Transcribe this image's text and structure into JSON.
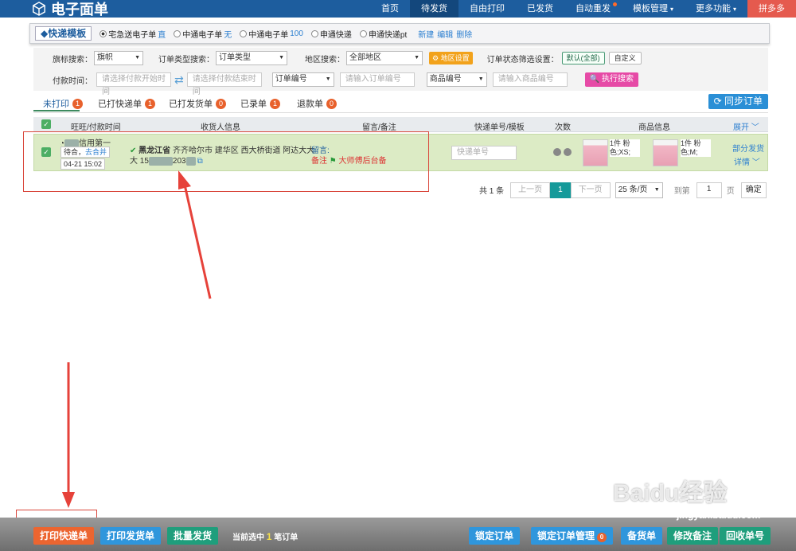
{
  "header": {
    "title": "电子面单",
    "nav": [
      {
        "label": "首页"
      },
      {
        "label": "待发货",
        "active": true
      },
      {
        "label": "自由打印"
      },
      {
        "label": "已发货"
      },
      {
        "label": "自动重发",
        "dot": true
      },
      {
        "label": "模板管理",
        "caret": "▾"
      },
      {
        "label": "更多功能",
        "caret": "▾"
      },
      {
        "label": "拼多多"
      }
    ]
  },
  "template_bar": {
    "title": "快递模板",
    "options": [
      {
        "label": "宅急送电子单",
        "tag": "直",
        "checked": true
      },
      {
        "label": "中通电子单",
        "tag": "无"
      },
      {
        "label": "中通电子单",
        "tag": "100"
      },
      {
        "label": "申通快递",
        "tag": ""
      },
      {
        "label": "申通快递pt",
        "tag": ""
      }
    ],
    "links": [
      "新建",
      "编辑",
      "删除"
    ]
  },
  "filters": {
    "flag_label": "旗标搜索：",
    "flag_value": "旗帜",
    "order_type_label": "订单类型搜索：",
    "order_type_value": "订单类型",
    "region_label": "地区搜索：",
    "region_value": "全部地区",
    "region_btn": "地区设置",
    "status_label": "订单状态筛选设置：",
    "status_default": "默认(全部)",
    "status_custom": "自定义",
    "pay_time_label": "付款时间：",
    "pay_start_ph": "请选择付款开始时间",
    "pay_end_ph": "请选择付款结束时间",
    "order_no_sel": "订单编号",
    "order_no_ph": "请输入订单编号",
    "goods_no_sel": "商品编号",
    "goods_no_ph": "请输入商品编号",
    "search_btn": "执行搜索"
  },
  "tabs": [
    {
      "label": "未打印",
      "count": "1"
    },
    {
      "label": "已打快递单",
      "count": "1"
    },
    {
      "label": "已打发货单",
      "count": "0"
    },
    {
      "label": "已录单",
      "count": "1"
    },
    {
      "label": "退款单",
      "count": "0"
    }
  ],
  "sync_btn": "同步订单",
  "table": {
    "headers": {
      "buyer": "旺旺/付款时间",
      "receiver": "收货人信息",
      "remark": "留言/备注",
      "express": "快递单号/模板",
      "times": "次数",
      "goods": "商品信息",
      "expand": "展开"
    },
    "row": {
      "buyer_tail": "信用第一",
      "status": "待合",
      "merge_link": "去合并",
      "pay_time": "04-21 15:02",
      "province": "黑龙江省",
      "address": "齐齐哈尔市 建华区 西大桥街道 阿达大大",
      "name_line": "大 15",
      "phone_mid": "203",
      "msg_label": "留言:",
      "note_label": "备注",
      "note_text": "大师傅后台备",
      "express_ph": "快递单号",
      "goods": [
        {
          "text": "1件 粉色;XS;"
        },
        {
          "text": "1件 粉色;M;"
        }
      ],
      "partial_ship": "部分发货",
      "detail": "详情"
    }
  },
  "pager": {
    "total": "共 1 条",
    "prev": "上一页",
    "current": "1",
    "next": "下一页",
    "per_page": "25 条/页",
    "goto_label": "到第",
    "goto_value": "1",
    "page_unit": "页",
    "confirm": "确定"
  },
  "footer": {
    "print_express": "打印快递单",
    "print_delivery": "打印发货单",
    "batch_ship": "批量发货",
    "selected_prefix": "当前选中",
    "selected_count": "1",
    "selected_suffix": "笔订单",
    "lock_order": "锁定订单",
    "lock_manage": "锁定订单管理",
    "lock_count": "0",
    "stock": "备货单",
    "edit_note": "修改备注",
    "recycle": "回收单号"
  },
  "watermark": {
    "brand": "Baidu经验",
    "url": "jingyan.baidu.com"
  },
  "colors": {
    "topbar": "#1d5d9e",
    "row_bg": "#dcebc5",
    "annotation_red": "#d9463b",
    "accent_orange": "#ec6530"
  }
}
